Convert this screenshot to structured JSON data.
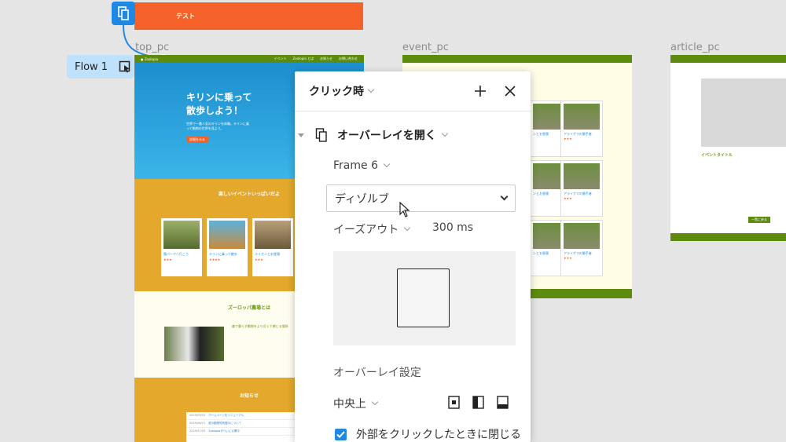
{
  "canvas": {
    "test_frame_label": "テスト",
    "flow_label": "Flow 1",
    "frames": [
      {
        "name": "top_pc"
      },
      {
        "name": "event_pc"
      },
      {
        "name": "article_pc"
      }
    ]
  },
  "top_pc": {
    "nav_links": [
      "イベント",
      "Zoolopia とは",
      "お知らせ",
      "お問い合わせ"
    ],
    "hero_title_line1": "キリンに乗って",
    "hero_title_line2": "散歩しよう！",
    "hero_text": "世界で一番人気のキリンを体験。キリンに乗って動物の世界を見よう。",
    "hero_button": "詳細をみる",
    "events_heading": "楽しいイベントいっぱいだよ",
    "cards": [
      {
        "title": "猿バークへ行こう",
        "stars": "★★★"
      },
      {
        "title": "キリンに乗って散歩",
        "stars": "★★★★"
      },
      {
        "title": "ライオンとお昼寝",
        "stars": "★★★"
      }
    ],
    "about_heading": "ズーロッパ農場とは",
    "about_subtitle": "森で暮らす動物をより近くで感じる場所",
    "news_heading": "お知らせ",
    "news": [
      {
        "date": "2019/09/01",
        "text": "ホームページをリニューアル"
      },
      {
        "date": "2019/08/11",
        "text": "夏の動物特別展示について"
      },
      {
        "date": "2019/07/20",
        "text": "Zoolopiaがついに公開中"
      }
    ]
  },
  "event_pc": {
    "cards": [
      {
        "title": "ンとお昼寝"
      },
      {
        "title": "アライグマの勝手者"
      },
      {
        "title": "ンとお昼寝"
      },
      {
        "title": "アライグマの勝手者"
      },
      {
        "title": "ンとお昼寝"
      },
      {
        "title": "アライグマの勝手者"
      }
    ]
  },
  "article_pc": {
    "title": "イベントタイトル",
    "button": "一覧に戻る"
  },
  "panel": {
    "trigger": "クリック時",
    "action": "オーバーレイを開く",
    "destination": "Frame 6",
    "animation": "ディゾルブ",
    "easing": "イーズアウト",
    "duration": "300 ms",
    "overlay_settings": "オーバーレイ設定",
    "position": "中央上",
    "close_on_outside_click": "外部をクリックしたときに閉じる",
    "close_on_outside_checked": true
  },
  "colors": {
    "accent": "#1e88e5",
    "brand_orange": "#f4622a",
    "brand_green": "#5d8b0d",
    "brand_gold": "#e3a82c"
  }
}
